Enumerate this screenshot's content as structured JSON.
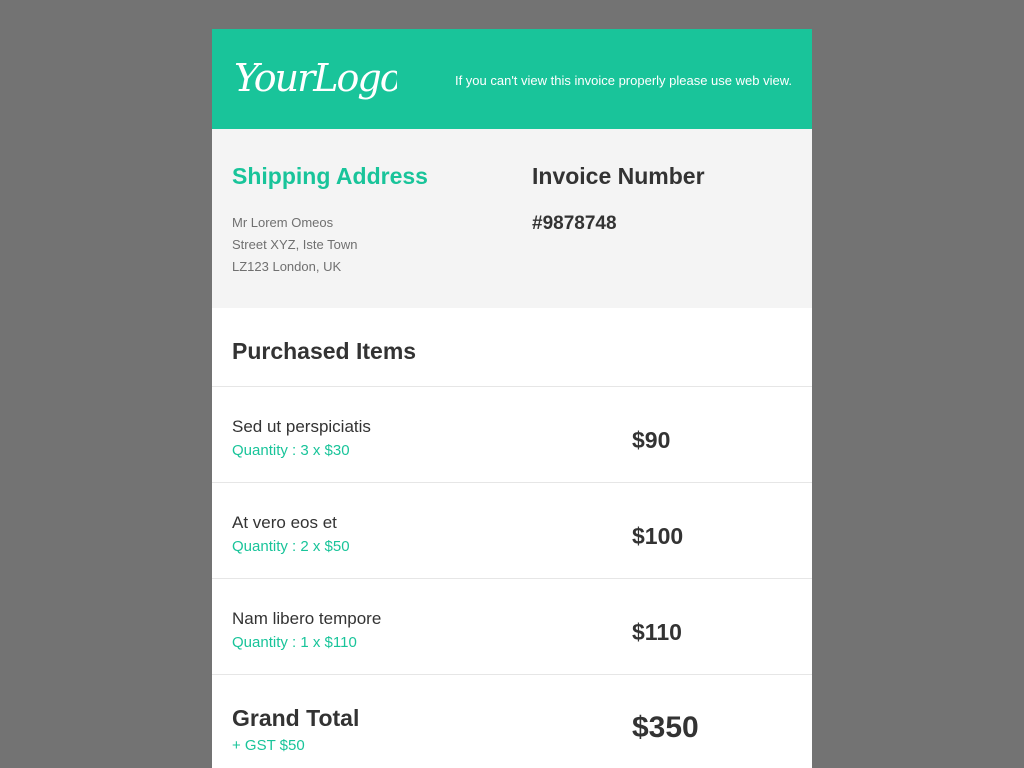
{
  "colors": {
    "accent": "#19c49a",
    "page_background": "#737373",
    "band_background": "#f4f4f4",
    "text_dark": "#333333"
  },
  "header": {
    "logo_text": "YourLogo",
    "web_view_note": "If you can't view this invoice properly please use web view."
  },
  "shipping": {
    "title": "Shipping Address",
    "lines": [
      "Mr Lorem Omeos",
      "Street XYZ, Iste Town",
      "LZ123 London, UK"
    ]
  },
  "invoice": {
    "title": "Invoice Number",
    "number": "#9878748"
  },
  "purchased": {
    "title": "Purchased Items",
    "items": [
      {
        "name": "Sed ut perspiciatis",
        "quantity": "Quantity : 3 x $30",
        "price": "$90"
      },
      {
        "name": "At vero eos et",
        "quantity": "Quantity : 2 x $50",
        "price": "$100"
      },
      {
        "name": "Nam libero tempore",
        "quantity": "Quantity : 1 x $110",
        "price": "$110"
      }
    ]
  },
  "total": {
    "label": "Grand Total",
    "gst": "+ GST $50",
    "amount": "$350"
  }
}
